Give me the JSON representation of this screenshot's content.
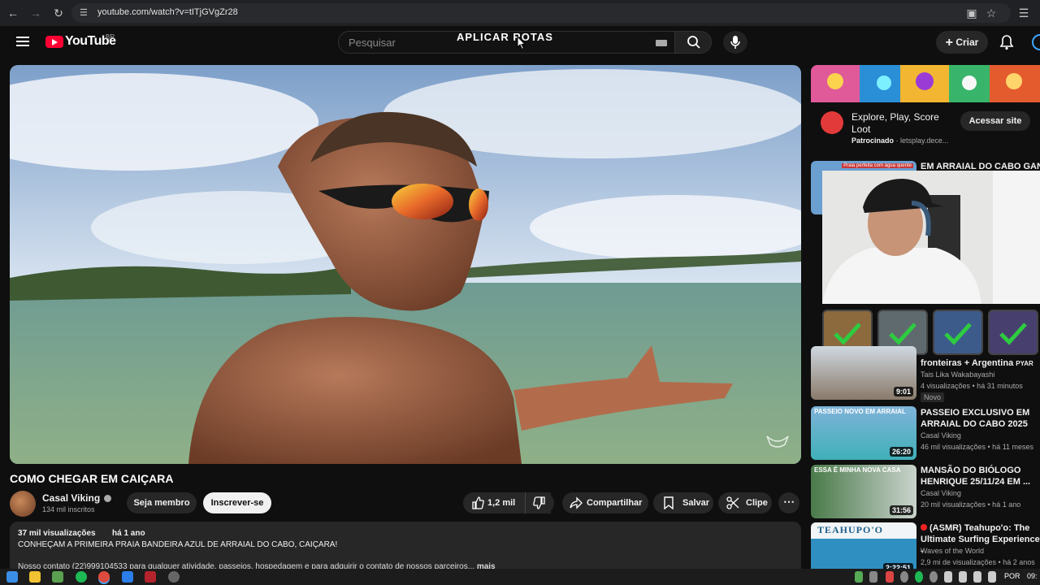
{
  "browser": {
    "url": "youtube.com/watch?v=tITjGVgZr28"
  },
  "header": {
    "logo_text": "YouTube",
    "region": "BR",
    "search_placeholder": "Pesquisar",
    "overlay_caption": "APLICAR ROTAS",
    "create_label": "Criar"
  },
  "video": {
    "title": "COMO CHEGAR EM CAIÇARA",
    "channel": {
      "name": "Casal Viking",
      "subscribers": "134 mil inscritos"
    },
    "join_label": "Seja membro",
    "subscribe_label": "Inscrever-se",
    "likes": "1,2 mil",
    "share_label": "Compartilhar",
    "save_label": "Salvar",
    "clip_label": "Clipe",
    "description": {
      "views": "37 mil visualizações",
      "age": "há 1 ano",
      "line1": "CONHEÇAM A PRIMEIRA PRAIA BANDEIRA AZUL DE ARRAIAL DO CABO, CAIÇARA!",
      "line2": "Nosso contato (22)999104533 para qualquer atividade, passeios, hospedagem e para adquirir o contato de nossos parceiros...",
      "more": "mais"
    }
  },
  "ad": {
    "title": "Explore, Play, Score Loot",
    "sponsored": "Patrocinado",
    "domain": "letsplay.dece...",
    "button": "Acessar site"
  },
  "sidebar": {
    "items": [
      {
        "title": "EM ARRAIAL DO CABO GANHA",
        "thumb_caption": "Praia perfeita com água quente"
      },
      {
        "title": "fronteiras + Argentina",
        "suffix": "PYAR",
        "channel": "Tais Lika Wakabayashi",
        "meta": "4 visualizações • há 31 minutos",
        "badge": "Novo",
        "duration": "9:01"
      },
      {
        "title": "PASSEIO EXCLUSIVO EM ARRAIAL DO CABO 2025",
        "channel": "Casal Viking",
        "meta": "46 mil visualizações • há 11 meses",
        "duration": "26:20",
        "thumb_caption": "PASSEIO NOVO EM ARRAIAL"
      },
      {
        "title": "MANSÃO DO BIÓLOGO HENRIQUE 25/11/24 EM ...",
        "channel": "Casal Viking",
        "meta": "20 mil visualizações • há 1 ano",
        "duration": "31:56",
        "thumb_caption": "ESSA É MINHA NOVA CASA"
      },
      {
        "title": "(ASMR) Teahupo'o: The Ultimate Surfing Experience -",
        "channel": "Waves of the World",
        "meta": "2,9 mi de visualizações • há 2 anos",
        "duration": "2:22:51",
        "thumb_caption": "TEAHUPO'O"
      }
    ]
  },
  "taskbar": {
    "lang": "POR",
    "time": "09:"
  },
  "colors": {
    "background": "#0f0f0f",
    "accent_red": "#ff0033",
    "chip": "#272727",
    "check_green": "#2ecc40"
  }
}
